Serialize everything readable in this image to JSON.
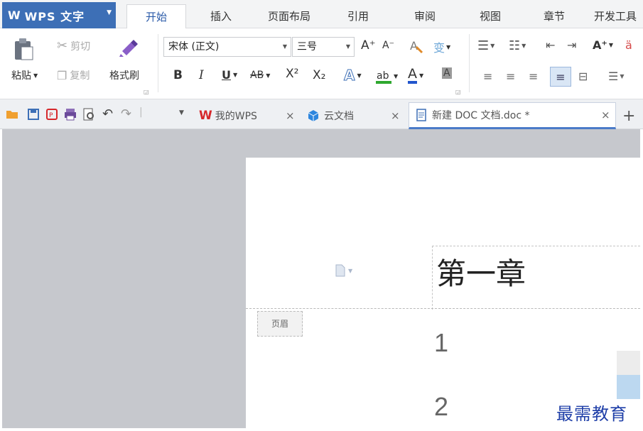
{
  "app": {
    "title": "WPS 文字",
    "logo": "W"
  },
  "menu_tabs": [
    "开始",
    "插入",
    "页面布局",
    "引用",
    "审阅",
    "视图",
    "章节",
    "开发工具"
  ],
  "clipboard": {
    "paste": "粘贴",
    "cut": "剪切",
    "copy": "复制",
    "format_painter": "格式刷"
  },
  "font": {
    "name": "宋体 (正文)",
    "size": "三号"
  },
  "format_buttons": {
    "bold": "B",
    "italic": "I",
    "underline": "U",
    "strikethrough": "AB",
    "superscript": "X²",
    "subscript": "X₂",
    "grow": "A⁺",
    "shrink": "A⁻",
    "font_color": "A",
    "char_shading": "A",
    "text_effect": "A"
  },
  "document_tabs": [
    {
      "label": "我的WPS",
      "icon": "wps-logo-icon",
      "active": false
    },
    {
      "label": "云文档",
      "icon": "cloud-cube-icon",
      "active": false
    },
    {
      "label": "新建 DOC 文档.doc *",
      "icon": "document-icon",
      "active": true
    }
  ],
  "document": {
    "header_text": "第一章",
    "header_label": "页眉",
    "line_numbers": [
      "1",
      "2"
    ]
  },
  "watermark": "最需教育",
  "colors": {
    "accent": "#3d6fb6",
    "active_tab_text": "#2a5aa8",
    "workspace_bg": "#c6c8cd",
    "highlight_green": "#2fa82f",
    "font_color_blue": "#2255cc",
    "wps_red": "#d6282b",
    "watermark": "#1f3fa8"
  }
}
